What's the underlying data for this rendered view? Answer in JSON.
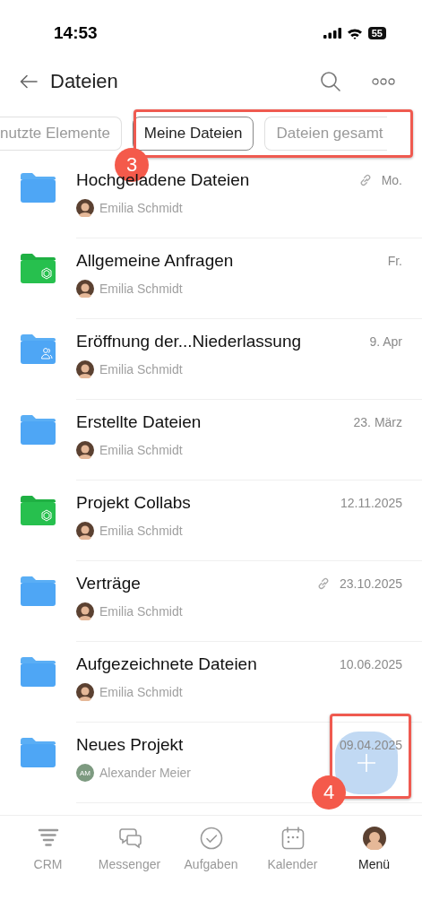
{
  "status_bar": {
    "time": "14:53",
    "battery": "55"
  },
  "header": {
    "title": "Dateien"
  },
  "filters": [
    {
      "label": "nutzte Elemente",
      "selected": false
    },
    {
      "label": "Meine Dateien",
      "selected": true
    },
    {
      "label": "Dateien gesamt",
      "selected": false
    }
  ],
  "files": [
    {
      "name": "Hochgeladene Dateien",
      "kind": "plain",
      "owner": "Emilia Schmidt",
      "date": "Mo.",
      "linked": true
    },
    {
      "name": "Allgemeine Anfragen",
      "kind": "group",
      "owner": "Emilia Schmidt",
      "date": "Fr.",
      "linked": false
    },
    {
      "name": "Eröffnung der...Niederlassung",
      "kind": "shared",
      "owner": "Emilia Schmidt",
      "date": "9. Apr",
      "linked": false
    },
    {
      "name": "Erstellte Dateien",
      "kind": "plain",
      "owner": "Emilia Schmidt",
      "date": "23. März",
      "linked": false
    },
    {
      "name": "Projekt Collabs",
      "kind": "group",
      "owner": "Emilia Schmidt",
      "date": "12.11.2025",
      "linked": false
    },
    {
      "name": "Verträge",
      "kind": "plain",
      "owner": "Emilia Schmidt",
      "date": "23.10.2025",
      "linked": true
    },
    {
      "name": "Aufgezeichnete Dateien",
      "kind": "plain",
      "owner": "Emilia Schmidt",
      "date": "10.06.2025",
      "linked": false
    },
    {
      "name": "Neues Projekt",
      "kind": "plain",
      "owner": "Alexander Meier",
      "owner_initials": "AM",
      "date": "09.04.2025",
      "linked": false
    }
  ],
  "tab_bar": [
    {
      "label": "CRM",
      "kind": "crm",
      "selected": false
    },
    {
      "label": "Messenger",
      "kind": "messenger",
      "selected": false
    },
    {
      "label": "Aufgaben",
      "kind": "tasks",
      "selected": false
    },
    {
      "label": "Kalender",
      "kind": "calendar",
      "selected": false
    },
    {
      "label": "Menü",
      "kind": "avatar",
      "selected": true
    }
  ],
  "callouts": [
    {
      "number": "3",
      "kind": "filters"
    },
    {
      "number": "4",
      "kind": "add"
    }
  ]
}
